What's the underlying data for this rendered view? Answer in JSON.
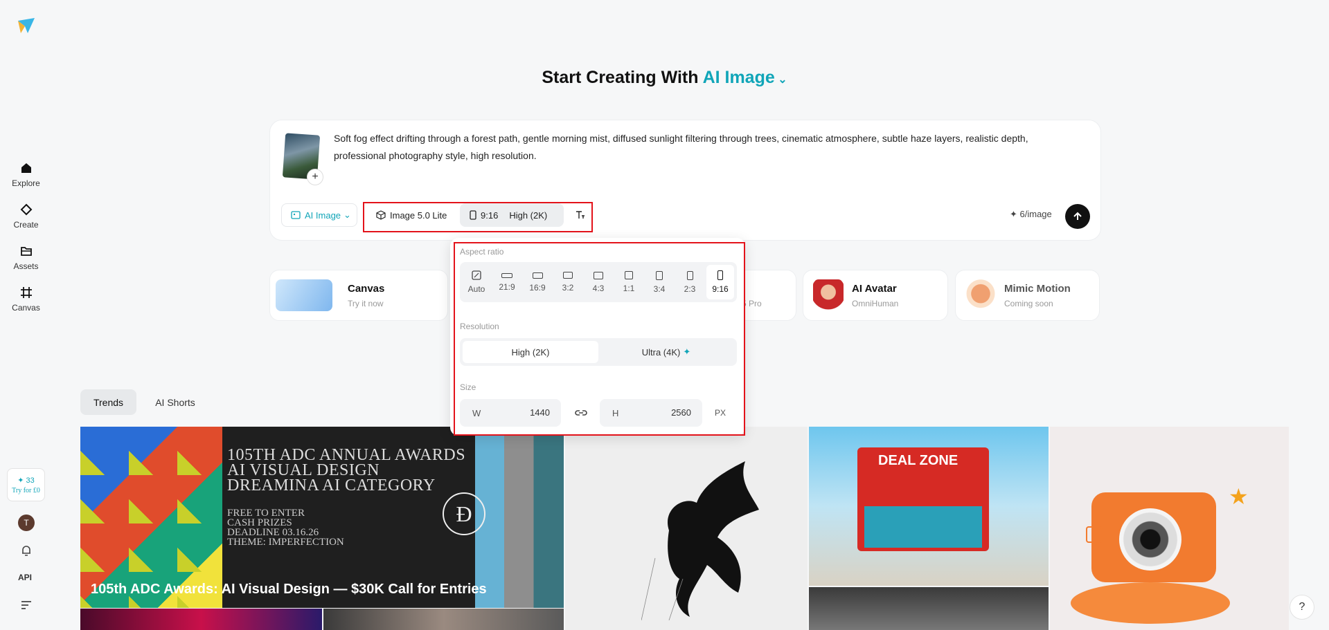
{
  "sidebar": {
    "items": [
      {
        "label": "Explore",
        "icon": "home-icon"
      },
      {
        "label": "Create",
        "icon": "diamond-icon"
      },
      {
        "label": "Assets",
        "icon": "folder-icon"
      },
      {
        "label": "Canvas",
        "icon": "canvas-icon"
      }
    ],
    "credits": "33",
    "try_label": "Try for £0",
    "avatar_initial": "T",
    "api_label": "API"
  },
  "heading": {
    "prefix": "Start Creating With",
    "accent": "AI Image"
  },
  "prompt": {
    "text": "Soft fog effect drifting through a forest path, gentle morning mist, diffused sunlight filtering through trees, cinematic atmosphere, subtle haze layers, realistic depth, professional photography style, high resolution.",
    "type_label": "AI Image",
    "model_label": "Image 5.0 Lite",
    "ratio_label": "9:16",
    "resolution_label": "High (2K)",
    "cost_label": "6/image"
  },
  "features": [
    {
      "title": "Canvas",
      "sub": "Try it now"
    },
    {
      "title": "AI Avatar",
      "sub": "OmniHuman"
    },
    {
      "title": "Mimic Motion",
      "sub": "Coming soon"
    }
  ],
  "feature_partial_sub": "5 Pro",
  "popover": {
    "aspect_label": "Aspect ratio",
    "ratios": [
      "Auto",
      "21:9",
      "16:9",
      "3:2",
      "4:3",
      "1:1",
      "3:4",
      "2:3",
      "9:16"
    ],
    "selected_ratio": "9:16",
    "resolution_label": "Resolution",
    "resolutions": [
      "High (2K)",
      "Ultra (4K)"
    ],
    "size_label": "Size",
    "width_label": "W",
    "width": "1440",
    "height_label": "H",
    "height": "2560",
    "unit": "PX"
  },
  "tabs": [
    "Trends",
    "AI Shorts"
  ],
  "gallery": {
    "caption": "105th ADC Awards: AI Visual Design — $30K Call for Entries",
    "poster_lines": [
      "105TH ADC ANNUAL AWARDS",
      "AI VISUAL DESIGN",
      "DREAMINA AI CATEGORY"
    ],
    "poster_small": [
      "FREE TO ENTER",
      "CASH PRIZES",
      "DEADLINE 03.16.26",
      "THEME: IMPERFECTION"
    ],
    "store_sign": "DEAL ZONE"
  },
  "colors": {
    "accent": "#10a5b8",
    "highlight": "#e3121a"
  }
}
